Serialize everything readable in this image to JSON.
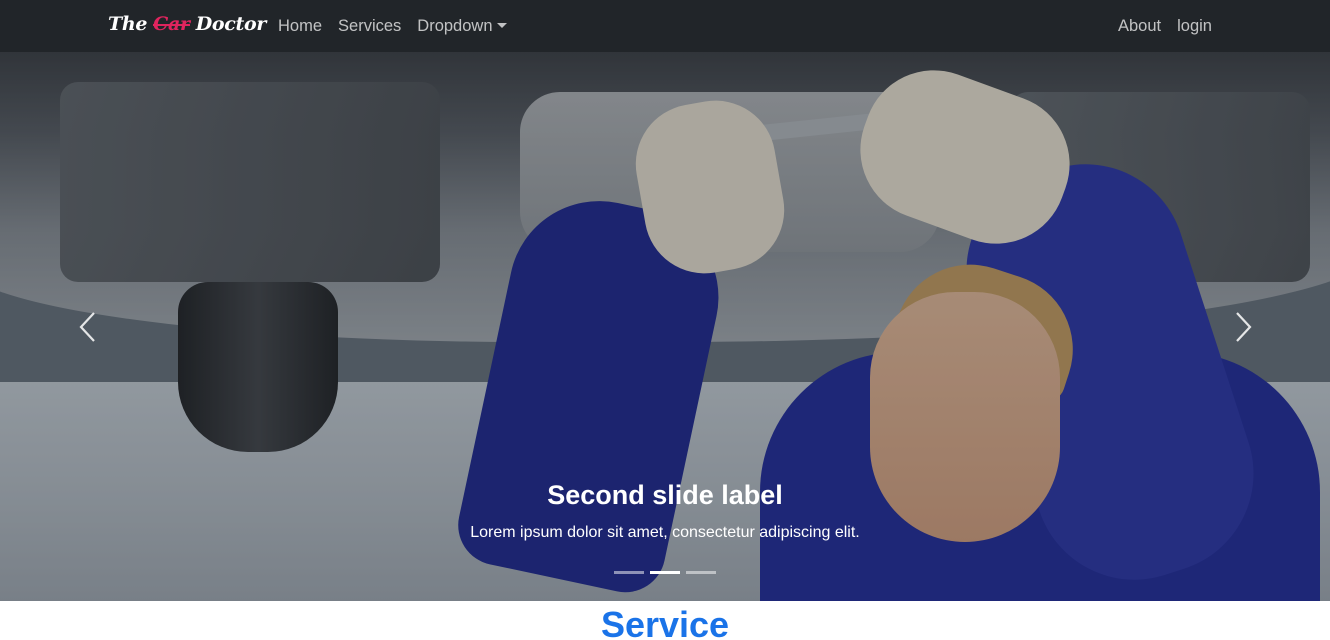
{
  "navbar": {
    "brand": {
      "word1": "The",
      "word2": "Car",
      "word3": "Doctor"
    },
    "links_left": [
      {
        "label": "Home"
      },
      {
        "label": "Services"
      },
      {
        "label": "Dropdown"
      }
    ],
    "links_right": [
      {
        "label": "About"
      },
      {
        "label": "login"
      }
    ]
  },
  "carousel": {
    "caption_title": "Second slide label",
    "caption_text": "Lorem ipsum dolor sit amet, consectetur adipiscing elit.",
    "indicator_count": 3,
    "active_index": 1,
    "icons": {
      "prev": "chevron-left-icon",
      "next": "chevron-right-icon"
    }
  },
  "section": {
    "title": "Service"
  },
  "colors": {
    "navbar_bg": "#212529",
    "brand_accent": "#e0245e",
    "section_title": "#1a73e8"
  }
}
